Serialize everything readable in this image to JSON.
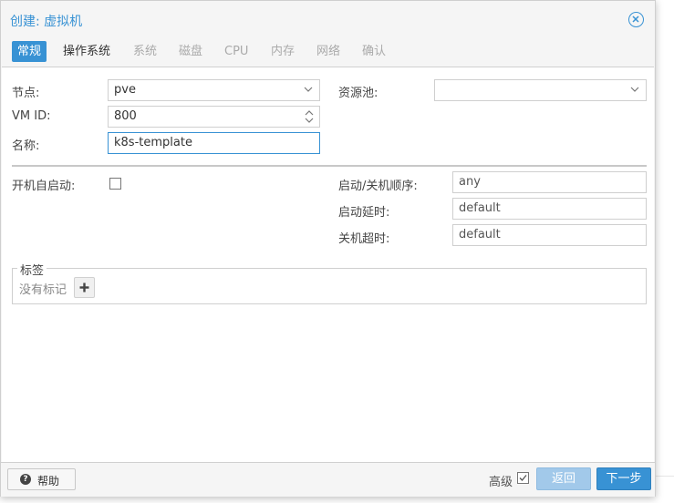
{
  "dialog": {
    "title": "创建: 虚拟机",
    "close_icon": "close-circle-icon"
  },
  "tabs": [
    {
      "label": "常规",
      "state": "active"
    },
    {
      "label": "操作系统",
      "state": "enabled"
    },
    {
      "label": "系统",
      "state": "disabled"
    },
    {
      "label": "磁盘",
      "state": "disabled"
    },
    {
      "label": "CPU",
      "state": "disabled"
    },
    {
      "label": "内存",
      "state": "disabled"
    },
    {
      "label": "网络",
      "state": "disabled"
    },
    {
      "label": "确认",
      "state": "disabled"
    }
  ],
  "form": {
    "node": {
      "label": "节点:",
      "value": "pve"
    },
    "vmid": {
      "label": "VM ID:",
      "value": "800"
    },
    "name": {
      "label": "名称:",
      "value": "k8s-template"
    },
    "pool": {
      "label": "资源池:",
      "value": ""
    },
    "onboot": {
      "label": "开机自启动:",
      "checked": false
    },
    "startup_order": {
      "label": "启动/关机顺序:",
      "value": "any"
    },
    "startup_delay": {
      "label": "启动延时:",
      "value": "default"
    },
    "shutdown_timeout": {
      "label": "关机超时:",
      "value": "default"
    }
  },
  "tags": {
    "legend": "标签",
    "empty_text": "没有标记",
    "add_icon": "plus-icon"
  },
  "footer": {
    "help_label": "帮助",
    "help_icon": "question-circle-icon",
    "advanced_label": "高级",
    "advanced_checked": true,
    "back_label": "返回",
    "next_label": "下一步"
  },
  "colors": {
    "accent": "#3892d4",
    "back_disabled": "#a2c9ea"
  }
}
